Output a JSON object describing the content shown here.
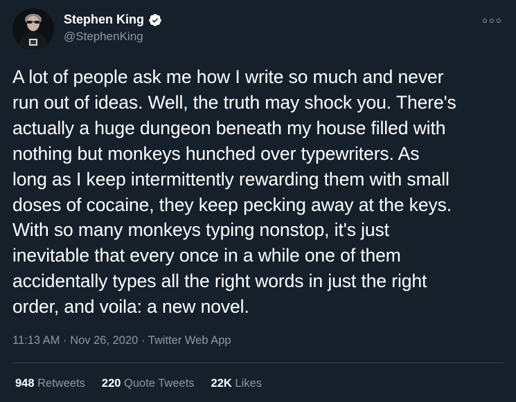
{
  "author": {
    "display_name": "Stephen King",
    "handle": "@StephenKing",
    "verified": true,
    "verified_color": "#ffffff",
    "avatar": "avatar-photo"
  },
  "tweet": {
    "text": "A lot of people ask me how I write so much and never\nrun out of ideas. Well, the truth may shock you. There's\nactually a huge dungeon beneath my house filled with\nnothing but monkeys hunched over typewriters. As\nlong as I keep intermittently rewarding them with small\ndoses of cocaine, they keep pecking away at the keys.\nWith so many monkeys typing nonstop, it's just\ninevitable that every once in a while one of them\naccidentally types all the right words in just the right\norder, and voila: a new novel.",
    "time": "11:13 AM",
    "date": "Nov 26, 2020",
    "source": "Twitter Web App",
    "separator": "·"
  },
  "stats": {
    "retweets_count": "948",
    "retweets_label": "Retweets",
    "quotes_count": "220",
    "quotes_label": "Quote Tweets",
    "likes_count": "22K",
    "likes_label": "Likes"
  },
  "colors": {
    "background": "#15202b",
    "secondary_text": "#8899a6",
    "divider": "#38444d",
    "primary_text": "#ffffff"
  },
  "icons": {
    "more": "more-options-icon",
    "verified": "verified-badge-icon"
  }
}
